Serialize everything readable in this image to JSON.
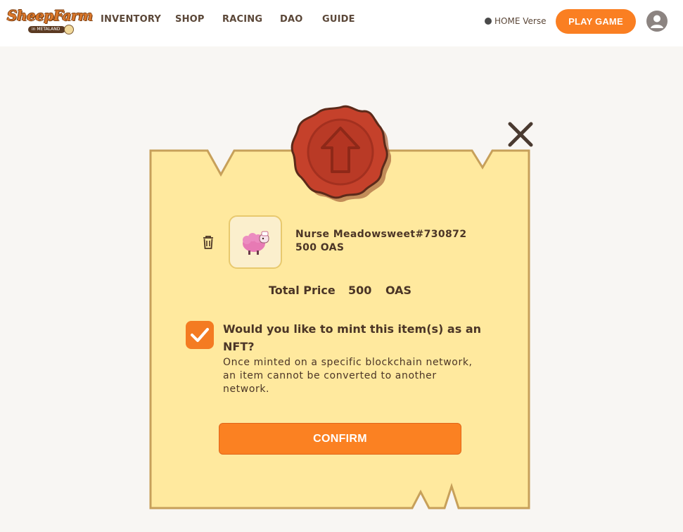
{
  "header": {
    "logo_text": "SheepFarm",
    "logo_subtext": "in METALAND",
    "nav": [
      {
        "label": "INVENTORY"
      },
      {
        "label": "SHOP"
      },
      {
        "label": "RACING"
      },
      {
        "label": "DAO"
      },
      {
        "label": "GUIDE"
      }
    ],
    "verse_label": "HOME Verse",
    "play_button": "PLAY GAME",
    "avatar_icon": "user-avatar-icon"
  },
  "modal": {
    "seal_icon": "arrow-up-icon",
    "close_icon": "close-icon",
    "item": {
      "name": "Nurse Meadowsweet#730872",
      "price": "500 OAS",
      "delete_icon": "trash-icon"
    },
    "total": {
      "label": "Total Price",
      "value": "500",
      "unit": "OAS"
    },
    "mint": {
      "checked": true,
      "question": "Would you like to mint this item(s) as an NFT?",
      "note": "Once minted on a specific blockchain network, an item cannot be converted to another network."
    },
    "confirm_label": "CONFIRM"
  },
  "colors": {
    "accent": "#fa7f22",
    "paper": "#ffe99e",
    "paper_border": "#c7a05a",
    "seal": "#c5412b",
    "text": "#4b3526",
    "background": "#f8f6f3"
  }
}
